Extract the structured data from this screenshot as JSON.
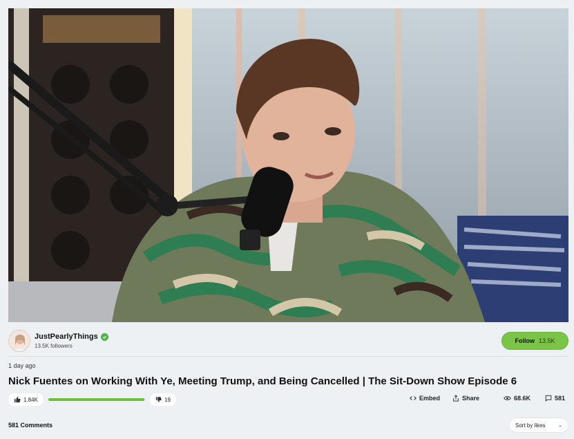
{
  "video": {
    "title": "Nick Fuentes on Working With Ye, Meeting Trump, and Being Cancelled | The Sit-Down Show Episode 6",
    "posted": "1 day ago"
  },
  "channel": {
    "name": "JustPearlyThings",
    "followers": "13.5K followers",
    "verified": true,
    "accent_color": "#4fb24a"
  },
  "follow": {
    "label": "Follow",
    "count": "13.5K",
    "color": "#7ac547"
  },
  "reactions": {
    "likes": "1.84K",
    "dislikes": "19",
    "like_ratio": 0.99,
    "bar_color": "#6cbf38"
  },
  "actions": {
    "embed": "Embed",
    "share": "Share",
    "views": "68.6K",
    "comments": "581"
  },
  "comments_section": {
    "heading": "581 Comments",
    "sort": "Sort by likes"
  },
  "icons": [
    "verified-check-icon",
    "thumbs-up-icon",
    "thumbs-down-icon",
    "code-icon",
    "share-icon",
    "eye-icon",
    "comment-icon",
    "chevron-down-icon"
  ]
}
